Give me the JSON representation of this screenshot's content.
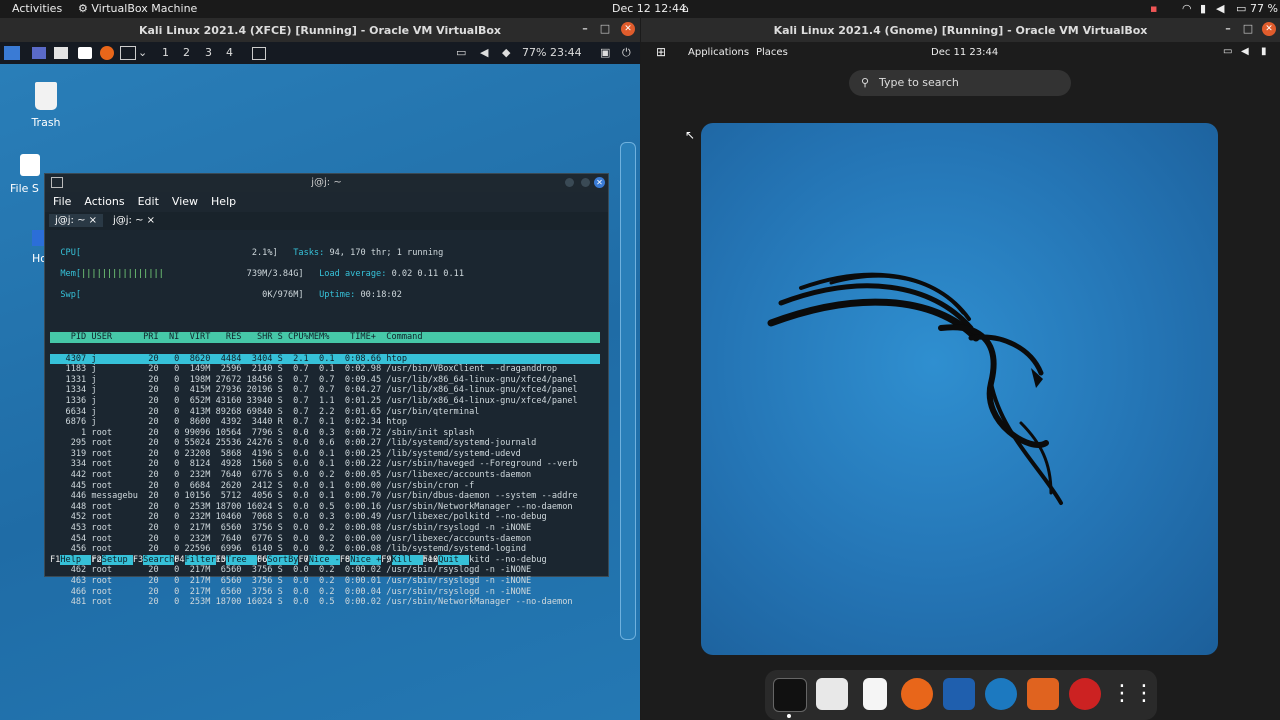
{
  "host": {
    "activities": "Activities",
    "app": "VirtualBox Machine",
    "datetime": "Dec 12  12:44",
    "battery": "77 %"
  },
  "left_window": {
    "title": "Kali Linux 2021.4 (XFCE) [Running] - Oracle VM VirtualBox",
    "panel": {
      "workspaces": [
        "1",
        "2",
        "3",
        "4"
      ],
      "battery_clock": "77% 23:44"
    },
    "desktop_icons": [
      {
        "label": "Trash"
      },
      {
        "label": "File S"
      },
      {
        "label": "Ho"
      }
    ],
    "terminal": {
      "title": "j@j: ~",
      "menu": [
        "File",
        "Actions",
        "Edit",
        "View",
        "Help"
      ],
      "tabs": [
        "j@j: ~",
        "j@j: ~"
      ],
      "meters": {
        "cpu_label": "CPU[",
        "cpu_value": "2.1%]",
        "mem_label": "Mem[",
        "mem_bars": "||||||||||||||||",
        "mem_value": "739M/3.84G]",
        "swp_label": "Swp[",
        "swp_value": "0K/976M]",
        "tasks_label": "Tasks:",
        "tasks_value": "94, 170 thr; 1 running",
        "load_label": "Load average:",
        "load_value": "0.02 0.11 0.11",
        "uptime_label": "Uptime:",
        "uptime_value": "00:18:02"
      },
      "header": "    PID USER      PRI  NI  VIRT   RES   SHR S CPU%MEM%    TIME+  Command",
      "rows": [
        "   4307 j          20   0  8620  4484  3404 S  2.1  0.1  0:08.66 htop",
        "   1183 j          20   0  149M  2596  2140 S  0.7  0.1  0:02.98 /usr/bin/VBoxClient --draganddrop",
        "   1331 j          20   0  198M 27672 18456 S  0.7  0.7  0:09.45 /usr/lib/x86_64-linux-gnu/xfce4/panel",
        "   1334 j          20   0  415M 27936 20196 S  0.7  0.7  0:04.27 /usr/lib/x86_64-linux-gnu/xfce4/panel",
        "   1336 j          20   0  652M 43160 33940 S  0.7  1.1  0:01.25 /usr/lib/x86_64-linux-gnu/xfce4/panel",
        "   6634 j          20   0  413M 89268 69840 S  0.7  2.2  0:01.65 /usr/bin/qterminal",
        "   6876 j          20   0  8600  4392  3440 R  0.7  0.1  0:02.34 htop",
        "      1 root       20   0 99096 10564  7796 S  0.0  0.3  0:00.72 /sbin/init splash",
        "    295 root       20   0 55024 25536 24276 S  0.0  0.6  0:00.27 /lib/systemd/systemd-journald",
        "    319 root       20   0 23208  5868  4196 S  0.0  0.1  0:00.25 /lib/systemd/systemd-udevd",
        "    334 root       20   0  8124  4928  1560 S  0.0  0.1  0:00.22 /usr/sbin/haveged --Foreground --verb",
        "    442 root       20   0  232M  7640  6776 S  0.0  0.2  0:00.05 /usr/libexec/accounts-daemon",
        "    445 root       20   0  6684  2620  2412 S  0.0  0.1  0:00.00 /usr/sbin/cron -f",
        "    446 messagebu  20   0 10156  5712  4056 S  0.0  0.1  0:00.70 /usr/bin/dbus-daemon --system --addre",
        "    448 root       20   0  253M 18700 16024 S  0.0  0.5  0:00.16 /usr/sbin/NetworkManager --no-daemon",
        "    452 root       20   0  232M 10460  7068 S  0.0  0.3  0:00.49 /usr/libexec/polkitd --no-debug",
        "    453 root       20   0  217M  6560  3756 S  0.0  0.2  0:00.08 /usr/sbin/rsyslogd -n -iNONE",
        "    454 root       20   0  232M  7640  6776 S  0.0  0.2  0:00.00 /usr/libexec/accounts-daemon",
        "    456 root       20   0 22596  6996  6140 S  0.0  0.2  0:00.08 /lib/systemd/systemd-logind",
        "    459 root       20   0  232M 10460  7068 S  0.0  0.3  0:00.00 /usr/libexec/polkitd --no-debug",
        "    462 root       20   0  217M  6560  3756 S  0.0  0.2  0:00.02 /usr/sbin/rsyslogd -n -iNONE",
        "    463 root       20   0  217M  6560  3756 S  0.0  0.2  0:00.01 /usr/sbin/rsyslogd -n -iNONE",
        "    466 root       20   0  217M  6560  3756 S  0.0  0.2  0:00.04 /usr/sbin/rsyslogd -n -iNONE",
        "    481 root       20   0  253M 18700 16024 S  0.0  0.5  0:00.02 /usr/sbin/NetworkManager --no-daemon"
      ],
      "fkeys": [
        {
          "key": "F1",
          "label": "Help  "
        },
        {
          "key": "F2",
          "label": "Setup "
        },
        {
          "key": "F3",
          "label": "Search"
        },
        {
          "key": "F4",
          "label": "Filter"
        },
        {
          "key": "F5",
          "label": "Tree  "
        },
        {
          "key": "F6",
          "label": "SortBy"
        },
        {
          "key": "F7",
          "label": "Nice -"
        },
        {
          "key": "F8",
          "label": "Nice +"
        },
        {
          "key": "F9",
          "label": "Kill  "
        },
        {
          "key": "F10",
          "label": "Quit  "
        }
      ]
    }
  },
  "right_window": {
    "title": "Kali Linux 2021.4 (Gnome) [Running] - Oracle VM VirtualBox",
    "applications": "Applications",
    "places": "Places",
    "clock": "Dec 11  23:44",
    "search_placeholder": "Type to search",
    "dock": [
      "terminal-icon",
      "files-icon",
      "text-editor-icon",
      "firefox-icon",
      "metasploit-icon",
      "wireshark-icon",
      "burpsuite-icon",
      "cherrytree-icon",
      "show-apps-icon"
    ]
  },
  "colors": {
    "htop_cyan": "#36c1d8",
    "htop_header": "#46c8a8",
    "kali_blue": "#2474b4"
  }
}
